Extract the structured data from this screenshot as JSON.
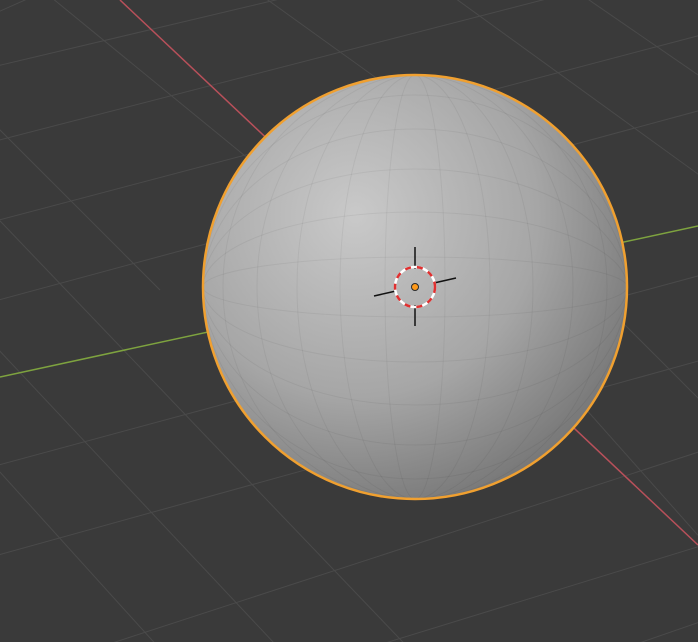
{
  "viewport": {
    "background_color": "#3a3a3a",
    "grid_color": "#4a4a4a",
    "x_axis_color": "#b8505a",
    "y_axis_color": "#7ea33f"
  },
  "object": {
    "type": "uv-sphere",
    "selected": true,
    "outline_color": "#f0a030",
    "shade_light": "#c9c9c9",
    "shade_mid": "#a6a6a6",
    "shade_dark": "#6e6e6e"
  },
  "origin": {
    "color": "#ff9a1a"
  },
  "cursor": {
    "ring_red": "#e03030",
    "ring_white": "#ffffff",
    "crosshair_color": "#111111"
  }
}
